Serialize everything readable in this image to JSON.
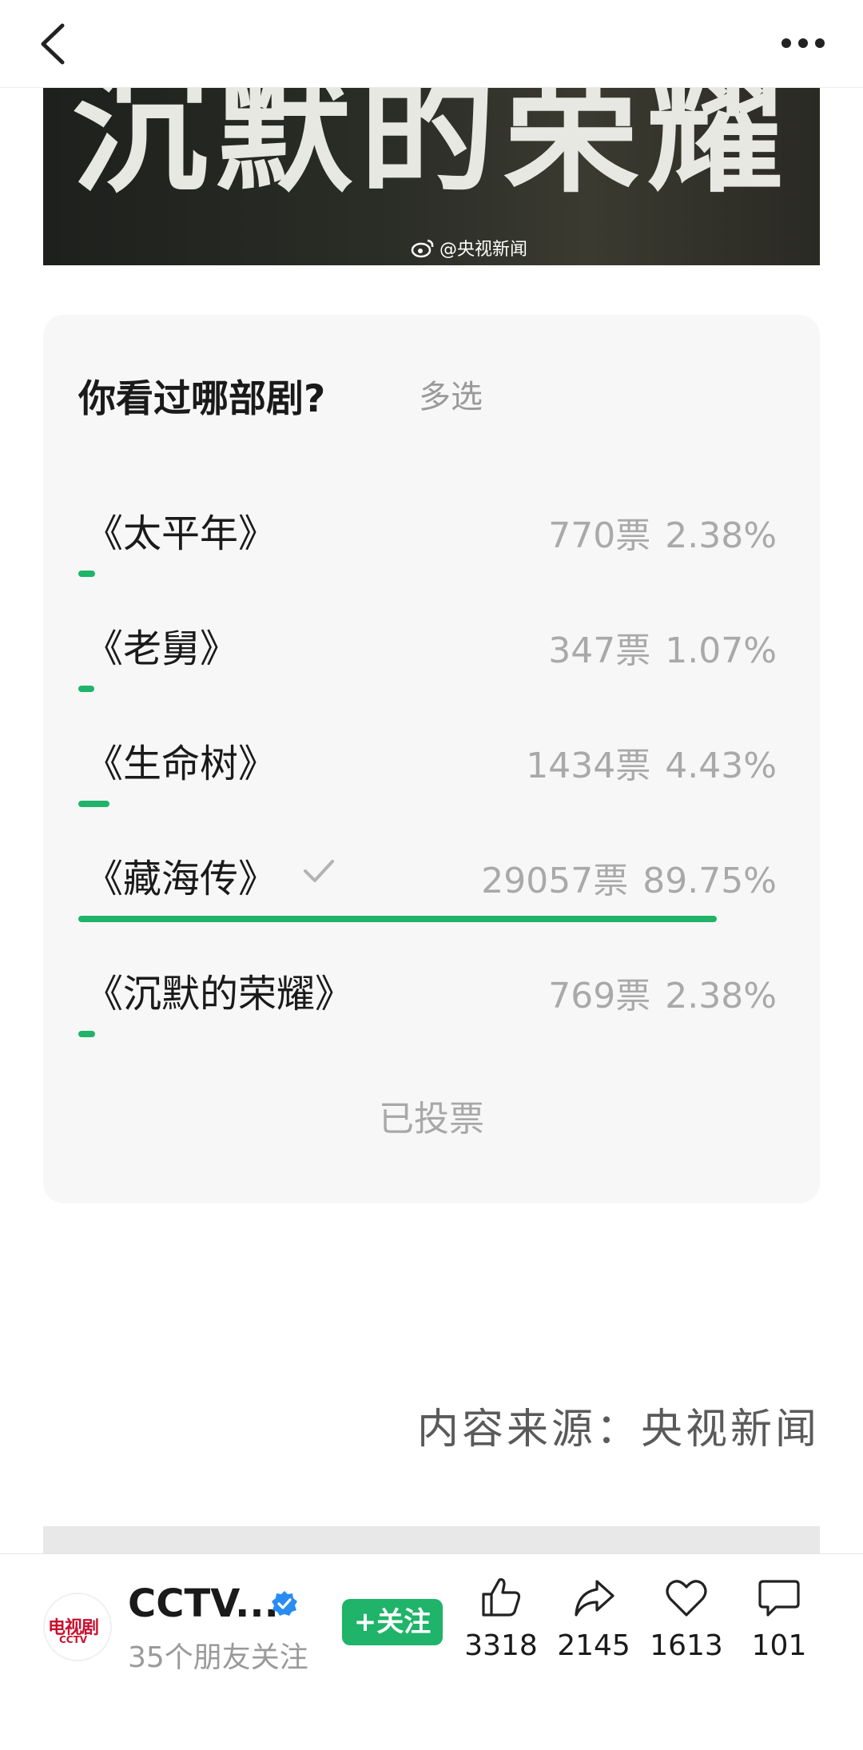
{
  "banner": {
    "title": "沉默的荣耀",
    "watermark": "@央视新闻"
  },
  "poll": {
    "question": "你看过哪部剧?",
    "mode": "多选",
    "options": [
      {
        "label": "《太平年》",
        "votes": "770票",
        "percent": "2.38%",
        "fraction": 0.0238,
        "checked": false
      },
      {
        "label": "《老舅》",
        "votes": "347票",
        "percent": "1.07%",
        "fraction": 0.0107,
        "checked": false
      },
      {
        "label": "《生命树》",
        "votes": "1434票",
        "percent": "4.43%",
        "fraction": 0.0443,
        "checked": false
      },
      {
        "label": "《藏海传》",
        "votes": "29057票",
        "percent": "89.75%",
        "fraction": 0.8975,
        "checked": true
      },
      {
        "label": "《沉默的荣耀》",
        "votes": "769票",
        "percent": "2.38%",
        "fraction": 0.0238,
        "checked": false
      }
    ],
    "status": "已投票"
  },
  "source": "内容来源：央视新闻",
  "account": {
    "name": "CCTV...",
    "avatar_text": "电视剧",
    "avatar_sub": "CCTV",
    "friends": "35个朋友关注",
    "follow_label": "+关注"
  },
  "actions": {
    "likes": "3318",
    "shares": "2145",
    "favorites": "1613",
    "comments": "101"
  },
  "colors": {
    "accent": "#1fb469",
    "verified": "#2a8cf0",
    "brand_red": "#c8102e"
  }
}
